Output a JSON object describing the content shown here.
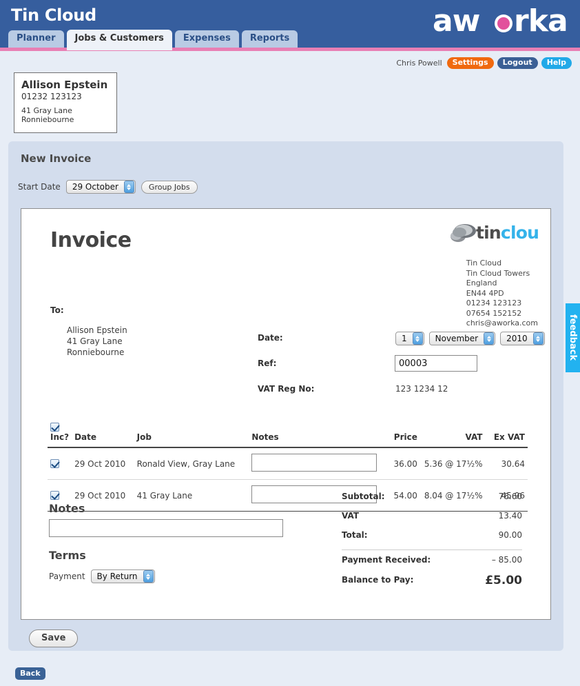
{
  "header": {
    "brand": "Tin Cloud",
    "logo_text": "aworka",
    "logo_accent_color": "#e2519c",
    "bar_color": "#365e9e",
    "rule_color": "#e87fb4",
    "tabs": [
      {
        "label": "Planner",
        "active": false
      },
      {
        "label": "Jobs & Customers",
        "active": true
      },
      {
        "label": "Expenses",
        "active": false
      },
      {
        "label": "Reports",
        "active": false
      }
    ]
  },
  "userbar": {
    "user_name": "Chris Powell",
    "settings": "Settings",
    "logout": "Logout",
    "help": "Help"
  },
  "customer_card": {
    "name": "Allison Epstein",
    "phone": "01232 123123",
    "address_line1": "41 Gray Lane",
    "address_line2": "Ronniebourne"
  },
  "panel": {
    "title": "New Invoice",
    "start_date_label": "Start Date",
    "start_date_value": "29 October",
    "group_jobs_label": "Group Jobs"
  },
  "invoice": {
    "title": "Invoice",
    "logo_tin": "tin",
    "logo_cloud": "cloud",
    "company": {
      "name": "Tin Cloud",
      "line2": "Tin Cloud Towers",
      "line3": "England",
      "postcode": "EN44 4PD",
      "phone": "01234 123123",
      "mobile": "07654 152152",
      "email": "chris@aworka.com"
    },
    "to_label": "To:",
    "to": {
      "name": "Allison Epstein",
      "line1": "41 Gray Lane",
      "line2": "Ronniebourne"
    },
    "date_label": "Date:",
    "date_day": "1",
    "date_month": "November",
    "date_year": "2010",
    "ref_label": "Ref:",
    "ref_value": "00003",
    "vat_reg_label": "VAT Reg No:",
    "vat_reg_value": "123 1234 12"
  },
  "items_table": {
    "headers": [
      "Inc?",
      "Date",
      "Job",
      "Notes",
      "Price",
      "VAT",
      "Ex VAT"
    ],
    "header_checkbox_checked": true,
    "rows": [
      {
        "included": true,
        "date": "29 Oct 2010",
        "job": "Ronald View, Gray Lane",
        "notes": "",
        "price": "36.00",
        "vat": "5.36 @ 17½%",
        "ex_vat": "30.64"
      },
      {
        "included": true,
        "date": "29 Oct 2010",
        "job": "41 Gray Lane",
        "notes": "",
        "price": "54.00",
        "vat": "8.04 @ 17½%",
        "ex_vat": "45.96"
      }
    ]
  },
  "notes_section": {
    "heading": "Notes",
    "value": ""
  },
  "terms_section": {
    "heading": "Terms",
    "payment_label": "Payment",
    "payment_value": "By Return"
  },
  "totals": {
    "subtotal_label": "Subtotal:",
    "subtotal_value": "76.60",
    "vat_label": "VAT",
    "vat_value": "13.40",
    "total_label": "Total:",
    "total_value": "90.00",
    "payment_received_label": "Payment Received:",
    "payment_received_value": "– 85.00",
    "balance_label": "Balance to Pay:",
    "balance_value": "£5.00"
  },
  "actions": {
    "save": "Save",
    "back": "Back"
  },
  "feedback": {
    "label": "feedback",
    "color": "#22b2f0"
  }
}
